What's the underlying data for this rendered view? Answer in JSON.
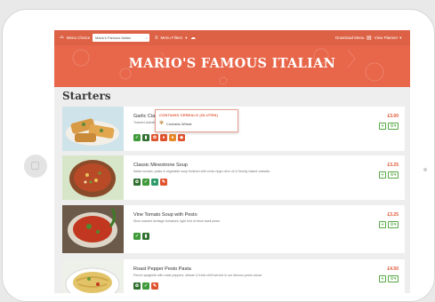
{
  "topbar": {
    "menu_choice_label": "Menu Choice",
    "restaurant_select": "Mario's Famous Italian",
    "menu_filters_label": "Menu Filters",
    "download_label": "Download Menu",
    "view_planner_label": "View Planner"
  },
  "restaurant_title": "MARIO'S FAMOUS ITALIAN",
  "section_title": "Starters",
  "items": [
    {
      "name": "Garlic Ciabatta",
      "desc": "Toasted ciabatta with garlic butter, served with parmesan shavings",
      "price": "£3.00"
    },
    {
      "name": "Classic Minestrone Soup",
      "desc": "Italian tomato, pasta & vegetable soup finished with extra virgin olive oil & freshly baked ciabatta",
      "price": "£3.25"
    },
    {
      "name": "Vine Tomato Soup with Pesto",
      "desc": "Slow roasted heritage tomatoes, light hint of fresh basil pesto",
      "price": "£3.25"
    },
    {
      "name": "Roast Pepper Pesto Pasta",
      "desc": "Penne spaghetti with roast peppers, artisan & fresh chilli served in our famous pesto sauce",
      "price": "£4.50"
    }
  ],
  "tooltip": {
    "heading": "CONTAINS CEREALS (GLUTEN)",
    "text": "Contains Wheat"
  },
  "colors": {
    "brand": "#e8664a",
    "accent": "#e15533",
    "green": "#56a844"
  }
}
